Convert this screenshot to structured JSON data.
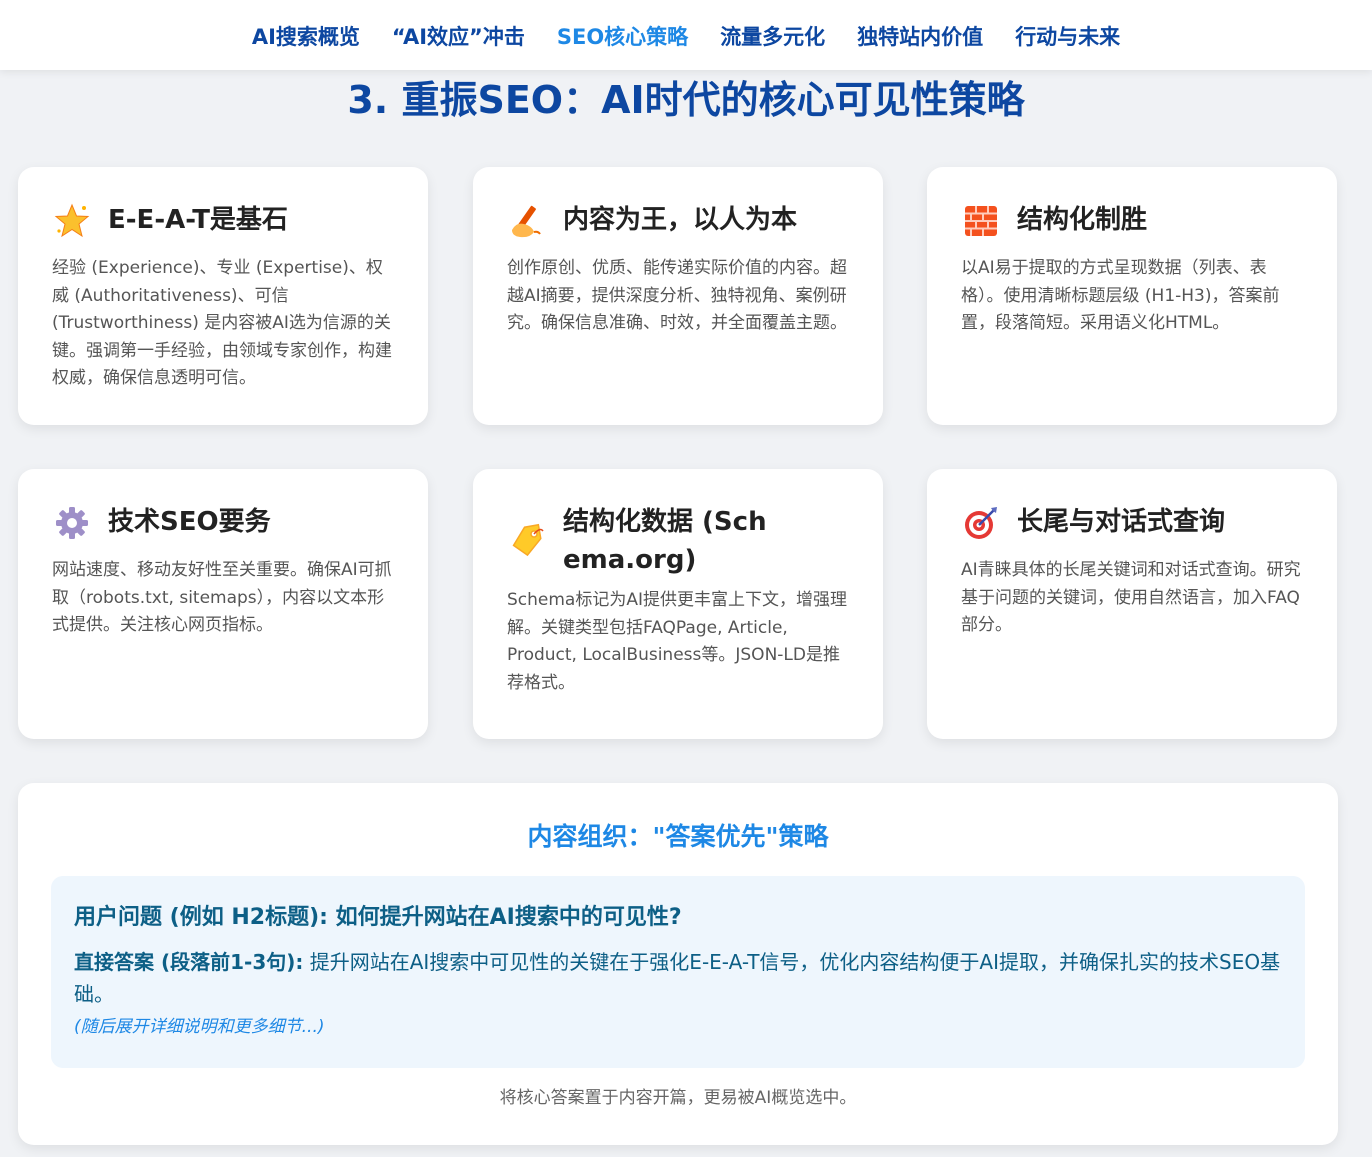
{
  "nav": {
    "items": [
      {
        "label": "AI搜索概览"
      },
      {
        "label": "“AI效应”冲击"
      },
      {
        "label": "SEO核心策略"
      },
      {
        "label": "流量多元化"
      },
      {
        "label": "独特站内价值"
      },
      {
        "label": "行动与未来"
      }
    ],
    "active_index": 2
  },
  "page": {
    "title": "3. 重振SEO：AI时代的核心可见性策略"
  },
  "cards": [
    {
      "icon": "glowing-star-icon",
      "title": "E-E-A-T是基石",
      "body": "经验 (Experience)、专业 (Expertise)、权威 (Authoritativeness)、可信 (Trustworthiness) 是内容被AI选为信源的关键。强调第一手经验，由领域专家创作，构建权威，确保信息透明可信。"
    },
    {
      "icon": "writing-hand-icon",
      "title": "内容为王，以人为本",
      "body": "创作原创、优质、能传递实际价值的内容。超越AI摘要，提供深度分析、独特视角、案例研究。确保信息准确、时效，并全面覆盖主题。"
    },
    {
      "icon": "bricks-icon",
      "title": "结构化制胜",
      "body": "以AI易于提取的方式呈现数据（列表、表格）。使用清晰标题层级 (H1-H3)，答案前置，段落简短。采用语义化HTML。"
    },
    {
      "icon": "gear-icon",
      "title": "技术SEO要务",
      "body": "网站速度、移动友好性至关重要。确保AI可抓取（robots.txt, sitemaps），内容以文本形式提供。关注核心网页指标。"
    },
    {
      "icon": "label-tag-icon",
      "title": "结构化数据 (Schema.org)",
      "body": "Schema标记为AI提供更丰富上下文，增强理解。关键类型包括FAQPage, Article, Product, LocalBusiness等。JSON-LD是推荐格式。"
    },
    {
      "icon": "direct-hit-target-icon",
      "title": "长尾与对话式查询",
      "body": "AI青睐具体的长尾关键词和对话式查询。研究基于问题的关键词，使用自然语言，加入FAQ部分。"
    }
  ],
  "strategy": {
    "title": "内容组织：\"答案优先\"策略",
    "question": "用户问题 (例如 H2标题): 如何提升网站在AI搜索中的可见性?",
    "answer_label": "直接答案 (段落前1-3句):",
    "answer_text": " 提升网站在AI搜索中可见性的关键在于强化E-E-A-T信号，优化内容结构便于AI提取，并确保扎实的技术SEO基础。",
    "note": "(随后展开详细说明和更多细节...)",
    "footer": "将核心答案置于内容开篇，更易被AI概览选中。"
  },
  "colors": {
    "nav_text": "#0d47a1",
    "nav_active": "#1e88e5",
    "title": "#0d47a1",
    "panel_title": "#1e88e5",
    "qa_background": "#eef6fd",
    "qa_text": "#0d5f86"
  }
}
